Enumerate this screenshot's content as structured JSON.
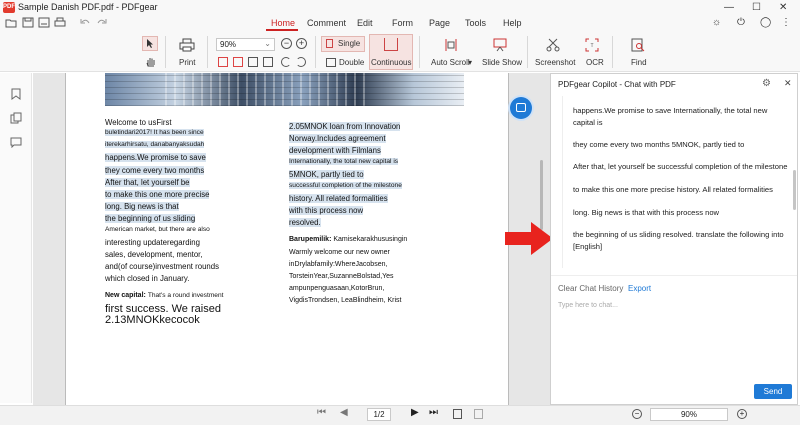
{
  "app": {
    "window_title": "Sample Danish PDF.pdf - PDFgear",
    "menu": [
      "Home",
      "Comment",
      "Edit",
      "Form",
      "Page",
      "Tools",
      "Help"
    ],
    "active_menu": "Home"
  },
  "ribbon": {
    "print": "Print",
    "zoom_value": "90%",
    "single": "Single",
    "double": "Double",
    "continuous": "Continuous",
    "auto_scroll": "Auto Scroll",
    "slide_show": "Slide Show",
    "screenshot": "Screenshot",
    "ocr": "OCR",
    "find": "Find"
  },
  "document": {
    "left_column": [
      {
        "text": "Welcome to usFirst",
        "hl": false,
        "size": "large"
      },
      {
        "text": "buletindari2017! It has been since",
        "hl": true,
        "size": "small"
      },
      {
        "text": "iterekarhirsatu, danabanyaksudah",
        "hl": true,
        "size": "small"
      },
      {
        "text": "happens.We promise to save",
        "hl": true,
        "size": "large"
      },
      {
        "text": "they come every two months",
        "hl": true,
        "size": "large"
      },
      {
        "text": "After that, let yourself be",
        "hl": true,
        "size": "large"
      },
      {
        "text": "to make this one more precise",
        "hl": true,
        "size": "large"
      },
      {
        "text": "long. Big news is that",
        "hl": true,
        "size": "large"
      },
      {
        "text": "the beginning of us sliding",
        "hl": true,
        "size": "large"
      },
      {
        "text": "American market, but there are also",
        "hl": false,
        "size": "small"
      },
      {
        "text": "interesting updateregarding",
        "hl": false,
        "size": "large"
      },
      {
        "text": "sales, development, mentor,",
        "hl": false,
        "size": "large"
      },
      {
        "text": "and(of course)investment rounds",
        "hl": false,
        "size": "large"
      },
      {
        "text": "which closed in January.",
        "hl": false,
        "size": "large"
      }
    ],
    "new_capital_label": "New capital:",
    "new_capital_text": "That's a round investment",
    "big_line_1": "first success. We raised",
    "big_line_2": "2.13MNOKkecocok",
    "right_column": [
      {
        "text": "2.05MNOK loan from Innovation",
        "hl": true,
        "size": "large"
      },
      {
        "text": "Norway.Includes agreement",
        "hl": true,
        "size": "large"
      },
      {
        "text": "development with Filmlans",
        "hl": true,
        "size": "large"
      },
      {
        "text": "Internationally, the total new capital is",
        "hl": true,
        "size": "small"
      },
      {
        "text": "5MNOK, partly tied to",
        "hl": true,
        "size": "large"
      },
      {
        "text": "successful completion of the milestone",
        "hl": true,
        "size": "small"
      },
      {
        "text": "history. All related formalities",
        "hl": true,
        "size": "large"
      },
      {
        "text": "with this process now",
        "hl": true,
        "size": "large"
      },
      {
        "text": "resolved.",
        "hl": true,
        "size": "large"
      }
    ],
    "barupemilik_label": "Barupemilik:",
    "barupemilik_text": "Kamisekarakhususingin",
    "right_column_2": [
      "Warmly welcome our new owner",
      "inDrylabfamily:WhereJacobsen,",
      "TorsteinYear,SuzanneBolstad,Yes",
      "ampunpenguasaan,KotorBrun,",
      "VigdisTrondsen, LeaBlindheim, Krist"
    ]
  },
  "chat": {
    "title": "PDFgear Copilot - Chat with PDF",
    "messages": [
      "happens.We promise to save Internationally, the total new",
      "capital is",
      "they come every two months 5MNOK, partly tied to",
      "After that, let yourself be successful completion of the milestone",
      "to make this one more precise history. All related formalities",
      "long. Big news is that with this process now",
      "the beginning of us sliding resolved. translate the following into",
      "[English]"
    ],
    "clear_history": "Clear Chat History",
    "export": "Export",
    "input_placeholder": "Type here to chat...",
    "send": "Send"
  },
  "statusbar": {
    "page_indicator": "1/2",
    "zoom": "90%"
  },
  "colors": {
    "accent": "#1f7ad6",
    "highlight": "#d6e2ee",
    "active_menu": "#cc2222",
    "arrow": "#e8231e"
  }
}
